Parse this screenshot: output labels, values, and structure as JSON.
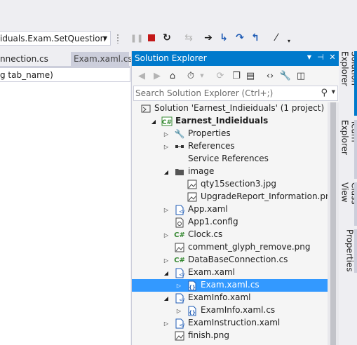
{
  "toolbar": {
    "combo_value": "iduals.Exam.SetQuestion"
  },
  "editor": {
    "tabs": [
      {
        "label": "nnection.cs"
      },
      {
        "label": "Exam.xaml.cs"
      }
    ],
    "nav_text": "g tab_name)"
  },
  "solution_explorer": {
    "title": "Solution Explorer",
    "search_placeholder": "Search Solution Explorer (Ctrl+;)",
    "tree": [
      {
        "label": "Solution 'Earnest_Indieiduals' (1 project)",
        "icon": "solution-icon",
        "expander": "none",
        "selected": false
      },
      {
        "label": "Earnest_Indieiduals",
        "icon": "csharp-project-icon",
        "expander": "expanded",
        "selected": false,
        "bold": true
      },
      {
        "label": "Properties",
        "icon": "wrench-icon",
        "expander": "collapsed",
        "selected": false
      },
      {
        "label": "References",
        "icon": "references-icon",
        "expander": "collapsed",
        "selected": false
      },
      {
        "label": "Service References",
        "icon": "none",
        "expander": "none",
        "selected": false
      },
      {
        "label": "image",
        "icon": "folder-icon",
        "expander": "expanded",
        "selected": false
      },
      {
        "label": "qty15section3.jpg",
        "icon": "image-file-icon",
        "expander": "none",
        "selected": false
      },
      {
        "label": "UpgradeReport_Information.png",
        "icon": "image-file-icon",
        "expander": "none",
        "selected": false
      },
      {
        "label": "App.xaml",
        "icon": "xaml-file-icon",
        "expander": "collapsed",
        "selected": false
      },
      {
        "label": "App1.config",
        "icon": "config-file-icon",
        "expander": "none",
        "selected": false
      },
      {
        "label": "Clock.cs",
        "icon": "csharp-file-icon",
        "expander": "collapsed",
        "selected": false
      },
      {
        "label": "comment_glyph_remove.png",
        "icon": "image-file-icon",
        "expander": "none",
        "selected": false
      },
      {
        "label": "DataBaseConnection.cs",
        "icon": "csharp-file-icon",
        "expander": "collapsed",
        "selected": false
      },
      {
        "label": "Exam.xaml",
        "icon": "xaml-file-icon",
        "expander": "expanded",
        "selected": false
      },
      {
        "label": "Exam.xaml.cs",
        "icon": "csharp-code-file-icon",
        "expander": "collapsed",
        "selected": true
      },
      {
        "label": "ExamInfo.xaml",
        "icon": "xaml-file-icon",
        "expander": "expanded",
        "selected": false
      },
      {
        "label": "ExamInfo.xaml.cs",
        "icon": "csharp-code-file-icon",
        "expander": "collapsed",
        "selected": false
      },
      {
        "label": "ExamInstruction.xaml",
        "icon": "xaml-file-icon",
        "expander": "collapsed",
        "selected": false
      },
      {
        "label": "finish.png",
        "icon": "image-file-icon",
        "expander": "none",
        "selected": false
      }
    ]
  },
  "side_tabs": [
    {
      "label": "Solution Explorer"
    },
    {
      "label": "Team Explorer"
    },
    {
      "label": "Class View"
    },
    {
      "label": "Properties"
    }
  ],
  "colors": {
    "accent": "#007acc",
    "selection": "#3399ff",
    "background": "#eeeef2"
  }
}
